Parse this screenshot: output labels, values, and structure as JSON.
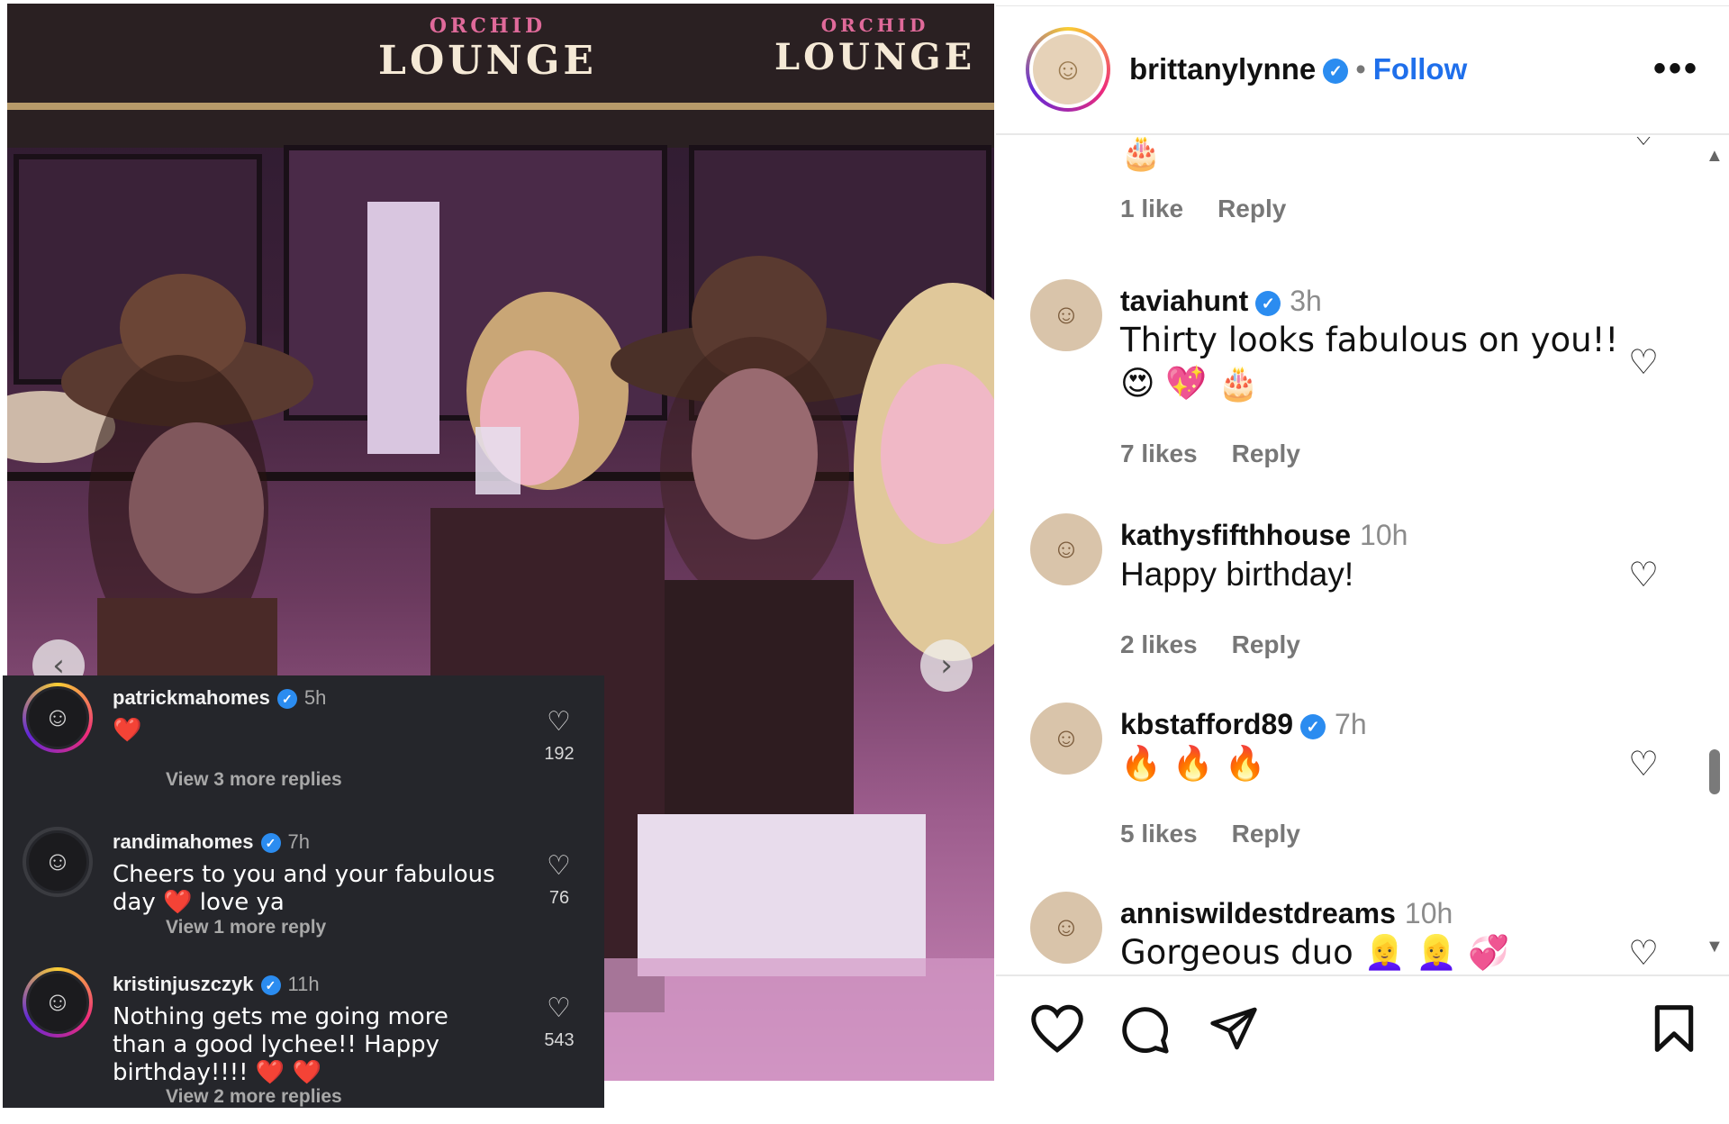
{
  "photo": {
    "signs": [
      "ORCHID",
      "LOUNGE",
      "ORCHID",
      "LOUNGE"
    ],
    "prev_icon": "chevron-left-icon",
    "next_icon": "chevron-right-icon"
  },
  "overlay_comments": [
    {
      "user": "patrickmahomes",
      "verified": true,
      "time": "5h",
      "text": "❤️",
      "likes": "192",
      "more": "View 3 more replies"
    },
    {
      "user": "randimahomes",
      "verified": true,
      "time": "7h",
      "text": "Cheers to you and your fabulous day ❤️ love ya",
      "likes": "76",
      "more": "View 1 more reply"
    },
    {
      "user": "kristinjuszczyk",
      "verified": true,
      "time": "11h",
      "text": "Nothing gets me going more than a good lychee!! Happy birthday!!!! ❤️ ❤️",
      "likes": "543",
      "more": "View 2 more replies"
    }
  ],
  "header": {
    "username": "brittanylynne",
    "verified": true,
    "separator": "•",
    "follow_label": "Follow",
    "more_icon": "more-options-icon"
  },
  "comments": [
    {
      "user": "",
      "time": "",
      "text": "🎂",
      "likes": "1 like",
      "reply": "Reply"
    },
    {
      "user": "taviahunt",
      "verified": true,
      "time": "3h",
      "text": "Thirty looks fabulous on you!! 😍 💖 🎂",
      "likes": "7 likes",
      "reply": "Reply"
    },
    {
      "user": "kathysfifthhouse",
      "verified": false,
      "time": "10h",
      "text": "Happy birthday!",
      "likes": "2 likes",
      "reply": "Reply"
    },
    {
      "user": "kbstafford89",
      "verified": true,
      "time": "7h",
      "text": "🔥 🔥 🔥",
      "likes": "5 likes",
      "reply": "Reply"
    },
    {
      "user": "anniswildestdreams",
      "verified": false,
      "time": "10h",
      "text": "Gorgeous duo 👱‍♀️ 👱‍♀️ 💞",
      "likes": "",
      "reply": ""
    }
  ],
  "actions": {
    "like_icon": "heart-icon",
    "comment_icon": "comment-icon",
    "share_icon": "send-icon",
    "save_icon": "bookmark-icon"
  },
  "colors": {
    "follow": "#1f6feb",
    "verified": "#2b8cf0",
    "overlay_bg": "#25262b",
    "heart_red": "#e0202e"
  }
}
